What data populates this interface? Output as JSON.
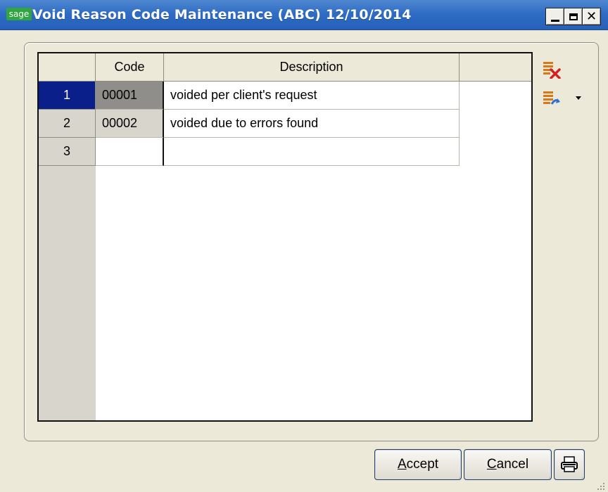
{
  "window": {
    "badge": "sage",
    "title": "Void Reason Code Maintenance (ABC) 12/10/2014",
    "min_icon": "minimize-icon",
    "max_icon": "maximize-icon",
    "close_icon": "close-icon",
    "close_glyph": "✕"
  },
  "grid": {
    "columns": {
      "code": "Code",
      "description": "Description"
    },
    "rows": [
      {
        "num": "1",
        "code": "00001",
        "description": "voided per client's request"
      },
      {
        "num": "2",
        "code": "00002",
        "description": "voided due to errors found"
      },
      {
        "num": "3",
        "code": "",
        "description": ""
      }
    ],
    "selected_row": "1"
  },
  "toolbar": {
    "delete_icon": "delete-lines-icon",
    "move_icon": "move-lines-icon"
  },
  "buttons": {
    "accept_mnemonic": "A",
    "accept_rest": "ccept",
    "cancel_mnemonic": "C",
    "cancel_rest": "ancel",
    "print_icon": "printer-icon"
  },
  "colors": {
    "titlebar": "#2f6cc4",
    "selected_row": "#0a1f8a",
    "badge": "#2fa63f"
  }
}
